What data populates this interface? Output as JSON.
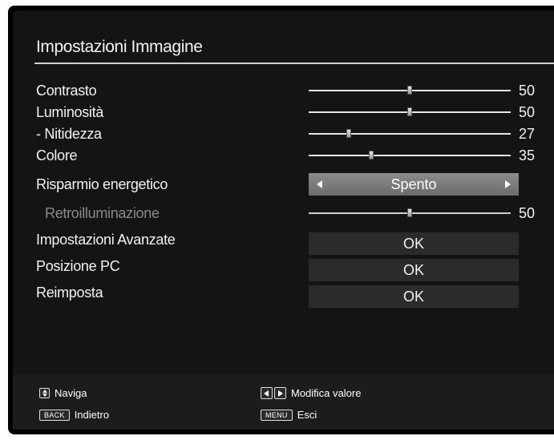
{
  "menu": {
    "title": "Impostazioni Immagine",
    "rows": [
      {
        "label": "Contrasto",
        "type": "slider",
        "value": "50",
        "level": 0.5,
        "enabled": true
      },
      {
        "label": "Luminosità",
        "type": "slider",
        "value": "50",
        "level": 0.5,
        "enabled": true
      },
      {
        "label": "- Nitidezza",
        "type": "slider",
        "value": "27",
        "level": 0.2,
        "enabled": true
      },
      {
        "label": "Colore",
        "type": "slider",
        "value": "35",
        "level": 0.31,
        "enabled": true
      },
      {
        "label": "Risparmio energetico",
        "type": "selector",
        "value": "Spento",
        "enabled": true
      },
      {
        "label": "Retroilluminazione",
        "type": "slider",
        "value": "50",
        "level": 0.5,
        "enabled": false
      },
      {
        "label": "Impostazioni Avanzate",
        "type": "button",
        "value": "OK",
        "enabled": true
      },
      {
        "label": "Posizione PC",
        "type": "button",
        "value": "OK",
        "enabled": true
      },
      {
        "label": "Reimposta",
        "type": "button",
        "value": "OK",
        "enabled": true
      }
    ]
  },
  "footer": {
    "navigate": {
      "icon": "up-down-arrows-icon",
      "label": "Naviga"
    },
    "modify": {
      "icon": "left-right-arrows-icon",
      "label": "Modifica valore"
    },
    "back": {
      "key": "BACK",
      "label": "Indietro"
    },
    "menu": {
      "key": "MENU",
      "label": "Esci"
    }
  },
  "colors": {
    "background": "#141414",
    "footer": "#1c1c1c",
    "text": "#f2f2f2",
    "disabled_text": "#8a8a8a",
    "selector": "#7a7a7a",
    "ok_box": "#2b2b2b"
  }
}
